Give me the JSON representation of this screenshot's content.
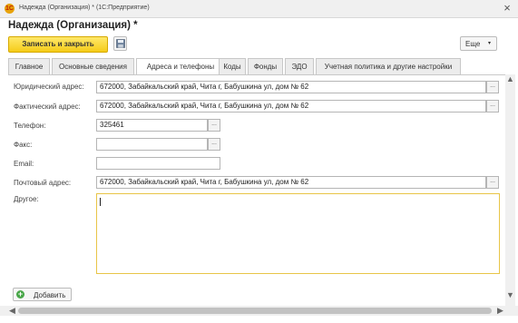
{
  "window": {
    "title": "Надежда (Организация) * (1С:Предприятие)",
    "app_icon_glyph": "1C",
    "close_glyph": "×"
  },
  "form": {
    "title": "Надежда (Организация) *"
  },
  "toolbar": {
    "save_close_label": "Записать и закрыть",
    "save_icon": "disk-icon",
    "more_label": "Еще",
    "more_arrow": "▾"
  },
  "tabs": [
    {
      "label": "Главное",
      "active": false
    },
    {
      "label": "Основные сведения",
      "active": false
    },
    {
      "label": "Адреса и телефоны",
      "active": true
    },
    {
      "label": "Коды",
      "active": false
    },
    {
      "label": "Фонды",
      "active": false
    },
    {
      "label": "ЭДО",
      "active": false
    },
    {
      "label": "Учетная политика и другие настройки",
      "active": false
    }
  ],
  "fields": {
    "legal_address": {
      "label": "Юридический адрес:",
      "value": "672000, Забайкальский край, Чита г, Бабушкина ул, дом № 62"
    },
    "actual_address": {
      "label": "Фактический адрес:",
      "value": "672000, Забайкальский край, Чита г, Бабушкина ул, дом № 62"
    },
    "phone": {
      "label": "Телефон:",
      "value": "325461"
    },
    "fax": {
      "label": "Факс:",
      "value": ""
    },
    "email": {
      "label": "Email:",
      "value": ""
    },
    "postal_address": {
      "label": "Почтовый адрес:",
      "value": "672000, Забайкальский край, Чита г, Бабушкина ул, дом № 62"
    },
    "other": {
      "label": "Другое:",
      "value": ""
    }
  },
  "field_button_glyph": "...",
  "add_button": {
    "label": "Добавить",
    "icon": "plus-icon",
    "glyph": "+"
  },
  "scroll": {
    "up": "▲",
    "down": "▼",
    "left": "◀",
    "right": "▶"
  },
  "colors": {
    "accent_yellow": "#f5cc19",
    "focus_border": "#e8c547",
    "add_green": "#48a648"
  }
}
